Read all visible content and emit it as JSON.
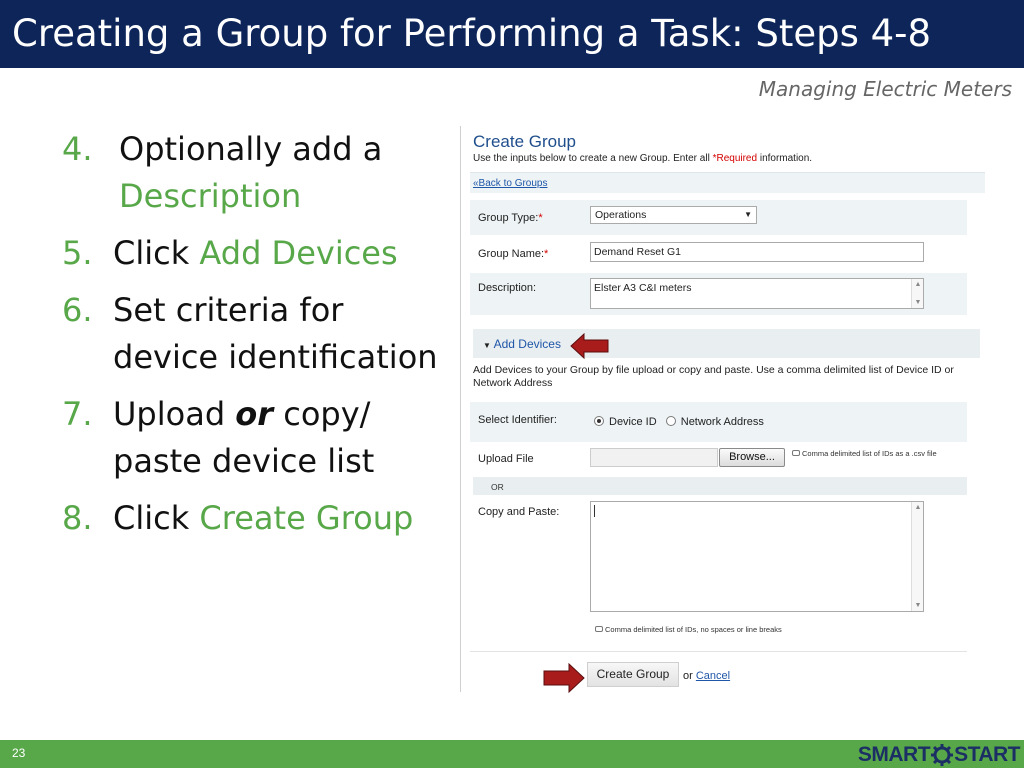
{
  "slide": {
    "title": "Creating a Group for Performing a Task: Steps 4-8",
    "subtitle": "Managing Electric Meters",
    "page_number": "23",
    "logo": {
      "left": "SMART",
      "right": "START"
    }
  },
  "steps": [
    {
      "number": "4.",
      "pre": "Optionally add a ",
      "highlight": "Description",
      "post": ""
    },
    {
      "number": "5.",
      "pre": "Click ",
      "highlight": "Add Devices",
      "post": ""
    },
    {
      "number": "6.",
      "pre": "Set criteria for device identification",
      "highlight": "",
      "post": ""
    },
    {
      "number": "7.",
      "pre": "Upload ",
      "emphasis": "or",
      "post": " copy/ paste device list"
    },
    {
      "number": "8.",
      "pre": "Click ",
      "highlight": "Create Group",
      "post": ""
    }
  ],
  "form": {
    "title": "Create Group",
    "intro_prefix": "Use the inputs below to create a new Group. Enter all ",
    "intro_required": "*Required",
    "intro_suffix": " information.",
    "back_link": "«Back to Groups",
    "group_type": {
      "label": "Group Type:",
      "required_mark": "*",
      "value": "Operations"
    },
    "group_name": {
      "label": "Group Name:",
      "required_mark": "*",
      "value": "Demand Reset G1"
    },
    "description": {
      "label": "Description:",
      "value": "Elster A3 C&I meters"
    },
    "add_devices": {
      "toggle_label": "Add Devices",
      "instructions": "Add Devices to your Group by file upload or copy and paste. Use a comma delimited list of Device ID or Network Address"
    },
    "select_identifier": {
      "label": "Select Identifier:",
      "options": [
        {
          "label": "Device ID",
          "selected": true
        },
        {
          "label": "Network Address",
          "selected": false
        }
      ]
    },
    "upload_file": {
      "label": "Upload File",
      "browse_label": "Browse...",
      "hint": "Comma delimited list of IDs as a .csv file"
    },
    "or_label": "OR",
    "copy_paste": {
      "label": "Copy and Paste:",
      "value": "",
      "hint": "Comma delimited list of IDs, no spaces or line breaks"
    },
    "create_button": "Create Group",
    "or_text": "or",
    "cancel_link": "Cancel"
  },
  "colors": {
    "title_bar": "#0d2559",
    "accent_green": "#58a84a",
    "footer": "#58a84a",
    "link_blue": "#1f56a8",
    "arrow_red": "#a81c1c",
    "required_red": "#d40000"
  }
}
